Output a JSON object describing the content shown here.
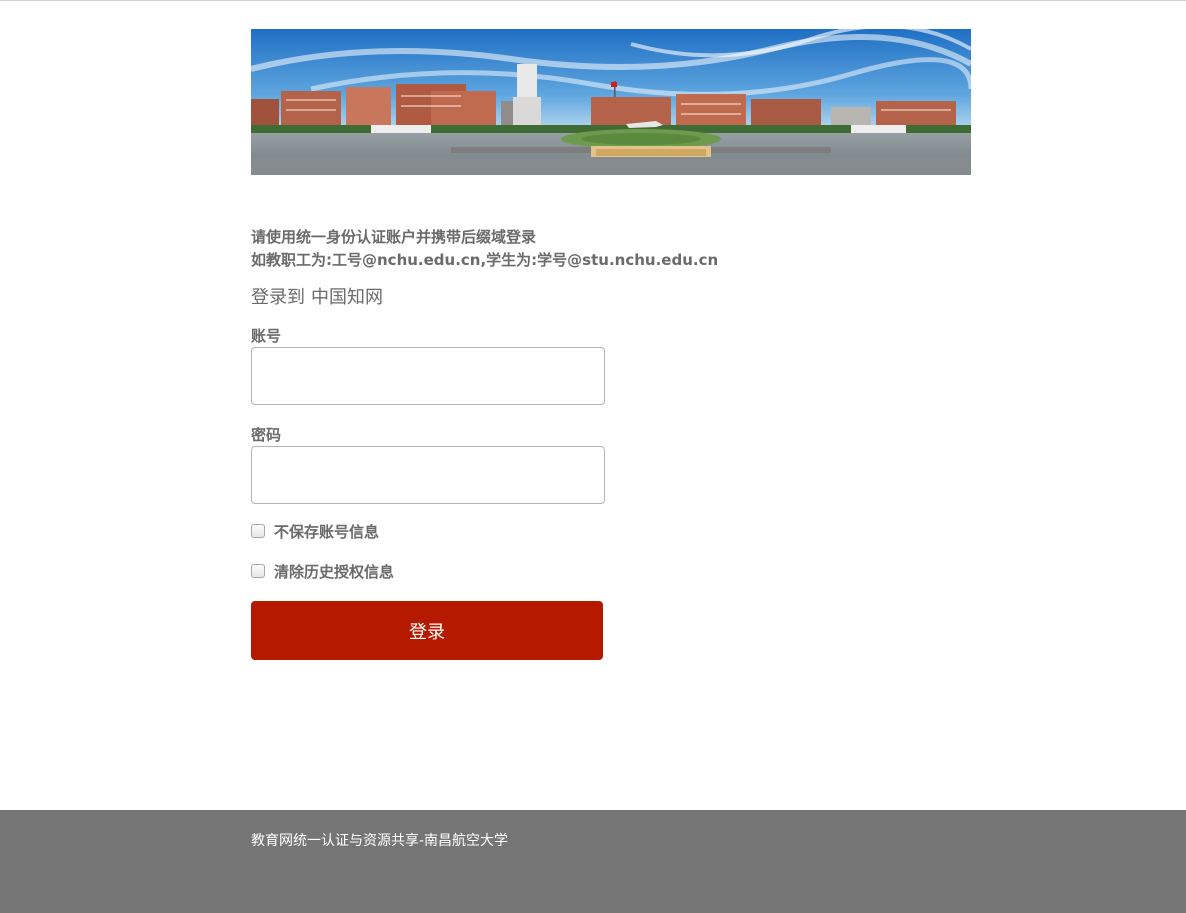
{
  "banner": {
    "alt": "南昌航空大学校园全景"
  },
  "notice": {
    "line1": "请使用统一身份认证账户并携带后缀域登录",
    "line2": "如教职工为:工号@nchu.edu.cn,学生为:学号@stu.nchu.edu.cn"
  },
  "login_to": {
    "prefix": "登录到",
    "service": "中国知网"
  },
  "form": {
    "username_label": "账号",
    "username_value": "",
    "password_label": "密码",
    "password_value": "",
    "dont_save_label": "不保存账号信息",
    "dont_save_checked": false,
    "clear_history_label": "清除历史授权信息",
    "clear_history_checked": false,
    "submit_label": "登录"
  },
  "footer": {
    "text": "教育网统一认证与资源共享-南昌航空大学"
  },
  "colors": {
    "button": "#b51a00",
    "footer": "#757575",
    "text": "#6b6b6b"
  }
}
